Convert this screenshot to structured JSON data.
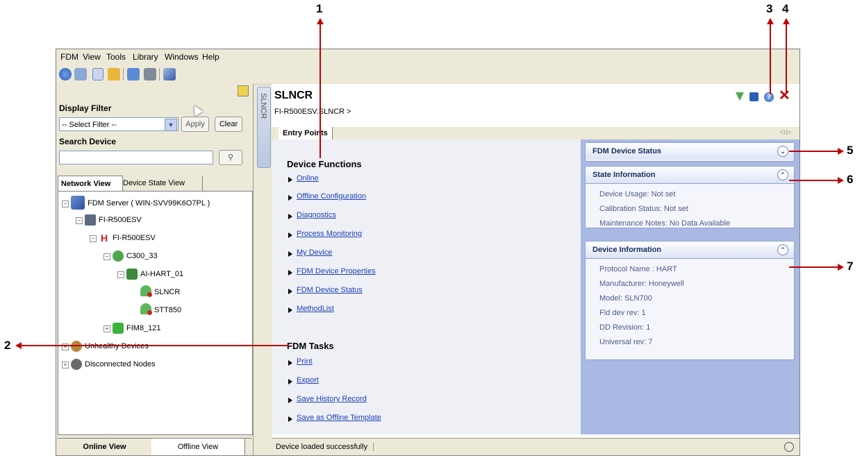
{
  "menu": [
    "FDM",
    "View",
    "Tools",
    "Library",
    "Windows",
    "Help"
  ],
  "left_panel": {
    "display_filter_label": "Display Filter",
    "filter_select_value": "-- Select Filter --",
    "apply_label": "Apply",
    "clear_label": "Clear",
    "search_device_label": "Search Device",
    "search_placeholder": "",
    "tabs": [
      "Network View",
      "Device State View"
    ],
    "tree": [
      "FDM Server ( WIN-SVV99K6O7PL )",
      "FI-R500ESV",
      "FI-R500ESV",
      "C300_33",
      "AI-HART_01",
      "SLNCR",
      "STT850",
      "FIM8_121",
      "Unhealthy Devices",
      "Disconnected Nodes"
    ],
    "bottom_tabs": [
      "Online View",
      "Offline View"
    ]
  },
  "vertical_tab": "SLNCR",
  "header": {
    "title": "SLNCR",
    "breadcrumb": "FI-R500ESV.SLNCR >",
    "tab": "Entry Points"
  },
  "device_functions": {
    "heading": "Device Functions",
    "items": [
      "Online",
      "Offline Configuration",
      "Diagnostics",
      "Process Monitoring",
      "My Device",
      "FDM Device Properties",
      "FDM Device Status",
      "MethodList"
    ]
  },
  "fdm_tasks": {
    "heading": "FDM Tasks",
    "items": [
      "Print",
      "Export",
      "Save History Record",
      "Save as Offline Template"
    ]
  },
  "cards": {
    "status_title": "FDM Device Status",
    "state_title": "State Information",
    "state_lines": [
      "Device Usage: Not set",
      "Calibration Status: Not set",
      "Maintenance Notes: No Data Available"
    ],
    "info_title": "Device Information",
    "info_lines": [
      "Protocol Name : HART",
      "Manufacturer: Honeywell",
      "Model: SLN700",
      "Fld dev rev: 1",
      "DD Revision: 1",
      "Universal rev: 7"
    ]
  },
  "status_bar": "Device loaded successfully",
  "callouts": [
    "1",
    "2",
    "3",
    "4",
    "5",
    "6",
    "7"
  ],
  "colors": {
    "link": "#1b3fb5",
    "callout_arrow": "#c00000",
    "sidebar": "#a9b9e4",
    "close": "#c00000"
  }
}
